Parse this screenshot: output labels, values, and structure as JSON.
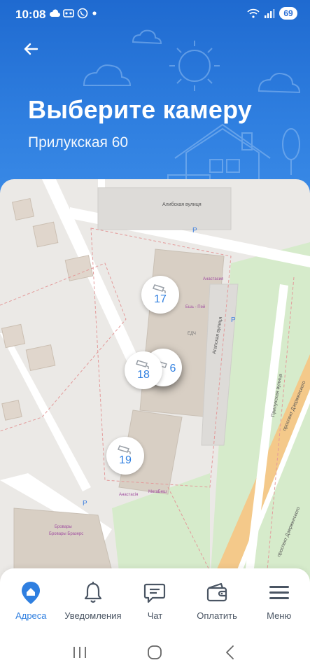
{
  "status": {
    "time": "10:08",
    "battery": "69"
  },
  "header": {
    "title": "Выберите камеру",
    "subtitle": "Прилукская 60"
  },
  "map": {
    "street_labels": [
      "Алибская вулиця",
      "Агапская вулиця",
      "Прилукская вулица",
      "проспект Дзержинского",
      "проспект Дзержинского"
    ],
    "poi_labels": [
      "Анастасия",
      "Ешь - Пей",
      "ЕДЧ",
      "Анастасія",
      "МегаБеш",
      "Бровары",
      "Бровары Бразерс"
    ],
    "parking_label": "P",
    "cameras": [
      {
        "number": "17"
      },
      {
        "number": "6"
      },
      {
        "number": "18"
      },
      {
        "number": "19"
      }
    ]
  },
  "bottom_nav": {
    "items": [
      {
        "label": "Адреса"
      },
      {
        "label": "Уведомления"
      },
      {
        "label": "Чат"
      },
      {
        "label": "Оплатить"
      },
      {
        "label": "Меню"
      }
    ]
  },
  "colors": {
    "primary": "#2f7fe0",
    "header_bg": "#1f6ad0",
    "map_bg": "#ebe9e6",
    "park": "#cfe7c4",
    "road": "#ffffff",
    "nav_text": "#4a5563"
  }
}
